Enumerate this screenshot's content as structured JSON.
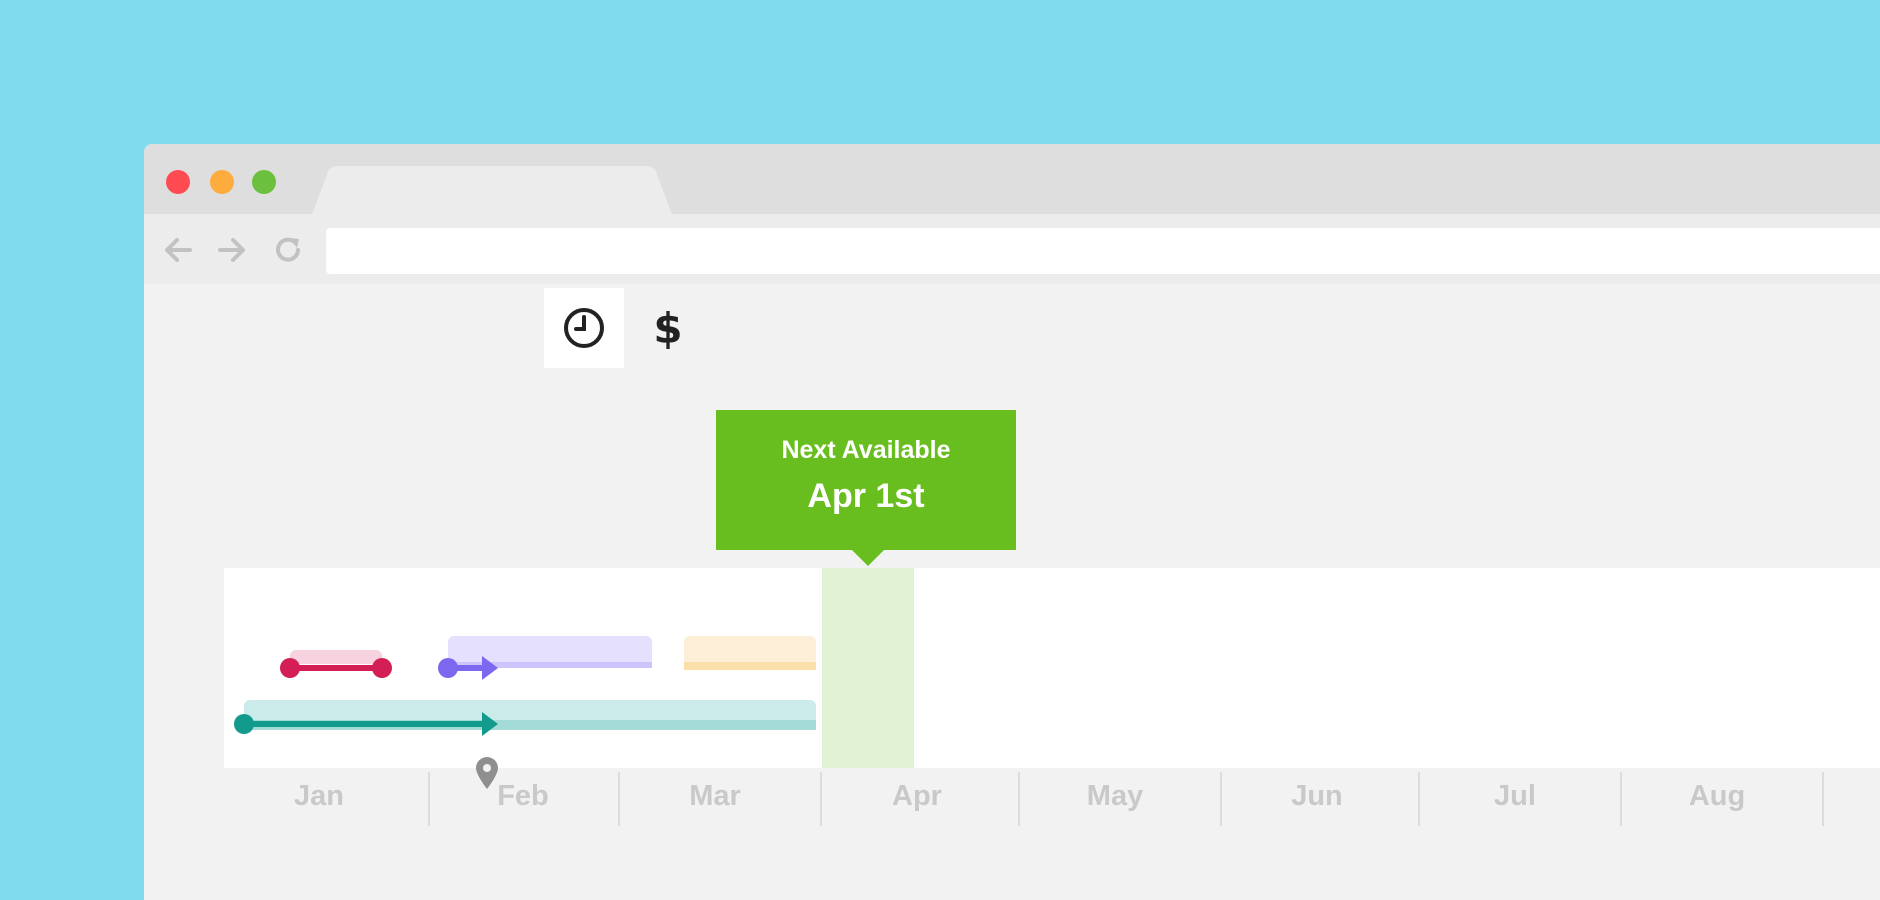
{
  "window": {
    "traffic_lights": {
      "close": "#fe4b51",
      "minimize": "#fdac3d",
      "maximize": "#6bc03e"
    },
    "tab_title": "",
    "address": ""
  },
  "toolbar": {
    "back": "arrow-left-icon",
    "forward": "arrow-right-icon",
    "reload": "reload-icon"
  },
  "mode": {
    "time": "clock-icon",
    "cost": "$",
    "active": "time"
  },
  "callout": {
    "label": "Next Available",
    "date": "Apr 1st",
    "color": "#69be1f"
  },
  "timeline": {
    "months": [
      "Jan",
      "Feb",
      "Mar",
      "Apr",
      "May",
      "Jun",
      "Jul",
      "Aug"
    ],
    "highlight_month": "Apr",
    "marker": "map-pin-icon",
    "tasks": [
      {
        "color": "#d31f55",
        "light": "#f7d3df"
      },
      {
        "color": "#7b68ee",
        "light": "#e5e0fd"
      },
      {
        "color": "#f8c98a",
        "light": "#fdeed8"
      },
      {
        "color": "#129b8c",
        "light": "#cbebea"
      }
    ]
  }
}
